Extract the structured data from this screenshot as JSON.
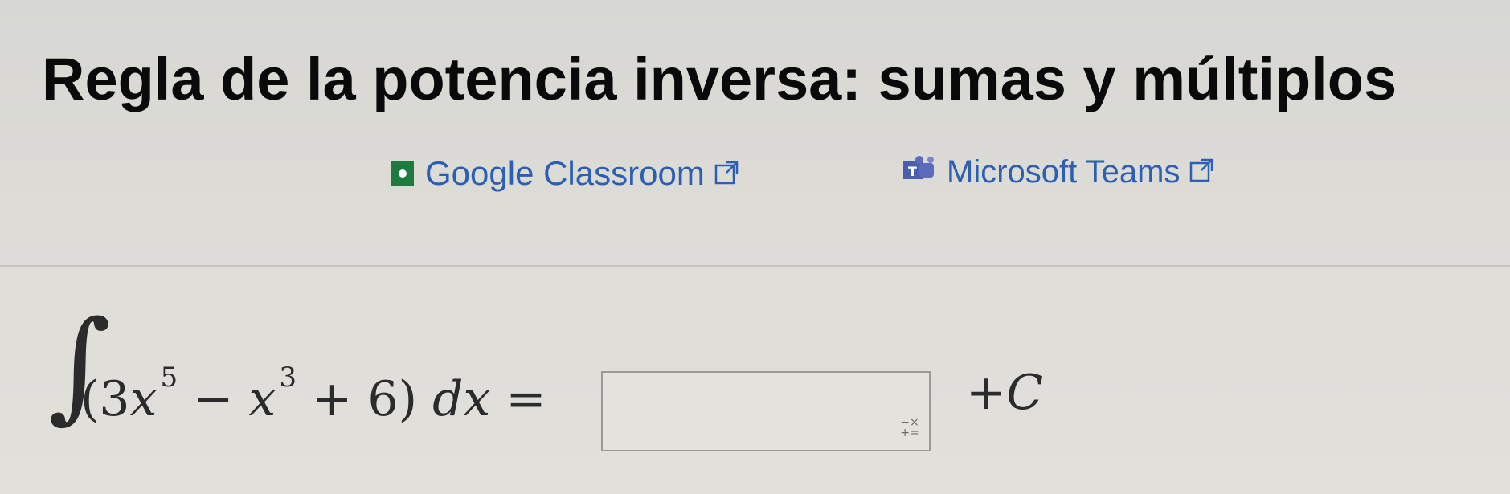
{
  "page": {
    "title": "Regla de la potencia inversa: sumas y múltiplos"
  },
  "share": {
    "google_classroom": {
      "label": "Google Classroom",
      "icon": "google-classroom-icon",
      "color": "#2b5fb4"
    },
    "microsoft_teams": {
      "label": "Microsoft Teams",
      "icon": "microsoft-teams-icon",
      "color": "#2d5fb3"
    },
    "external_icon": "external-link-icon"
  },
  "problem": {
    "integral_sign": "∫",
    "open_paren": "(3",
    "var1": "x",
    "exp1": "5",
    "minus": " − ",
    "var2": "x",
    "exp2": "3",
    "rest": " + 6) ",
    "differential": "dx",
    "equals": " =",
    "answer_value": "",
    "input_icon": "math-keypad-icon",
    "constant": "+C"
  }
}
